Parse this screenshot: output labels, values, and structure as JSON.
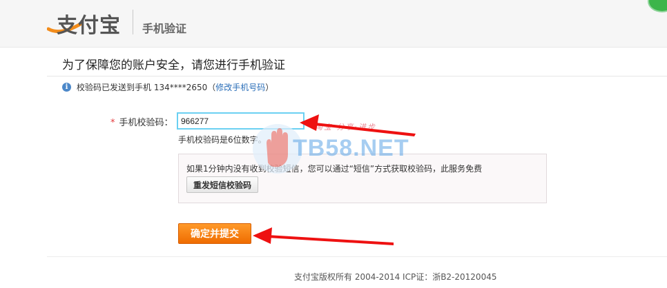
{
  "header": {
    "logo_text": "支付宝",
    "subtitle": "手机验证"
  },
  "page_title": "为了保障您的账户安全，请您进行手机验证",
  "info": {
    "sent_text": "校验码已发送到手机 134****2650",
    "paren_open": "（",
    "change_link": "修改手机号码",
    "paren_close": "）"
  },
  "form": {
    "required_mark": "*",
    "code_label": "手机校验码：",
    "code_value": "966277",
    "hint": "手机校验码是6位数字。"
  },
  "resend": {
    "text": "如果1分钟内没有收到校验短信，您可以通过“短信”方式获取校验码，此服务免费",
    "button_label": "重发短信校验码"
  },
  "submit_label": "确定并提交",
  "footer": "支付宝版权所有 2004-2014 ICP证：浙B2-20120045",
  "watermark": {
    "text": "TB58.NET",
    "slogan": "淘宝·分享·进步"
  },
  "colors": {
    "accent_orange": "#ef6c00",
    "input_focus": "#6ad0f2",
    "link": "#2a6eb8",
    "arrow_red": "#e11"
  }
}
